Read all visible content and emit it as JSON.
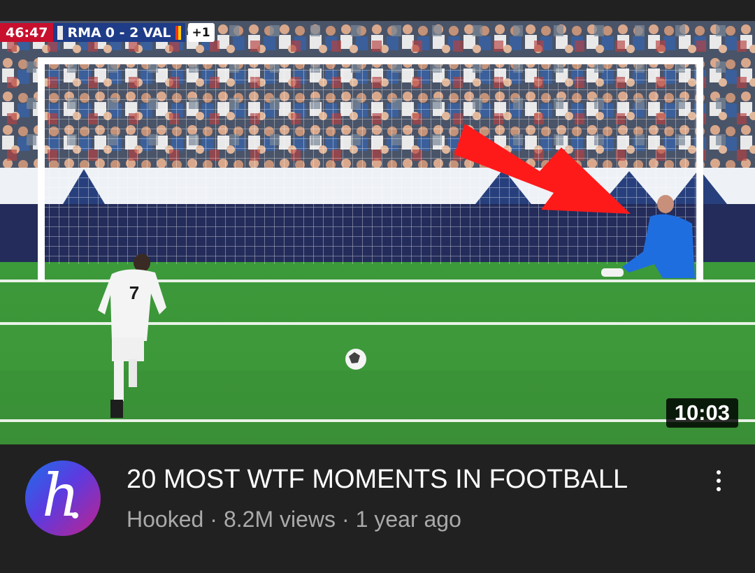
{
  "video": {
    "scoreboard": {
      "clock": "46:47",
      "home": "RMA",
      "score": "0 - 2",
      "away": "VAL",
      "extra_time": "+1"
    },
    "duration": "10:03",
    "title": "20 MOST WTF MOMENTS IN FOOTBALL",
    "channel": "Hooked",
    "views": "8.2M views",
    "age": "1 year ago",
    "separator": "·",
    "player_number": "7"
  },
  "channel_avatar": {
    "glyph": "h",
    "colors": [
      "#1e6fe8",
      "#5b3be0",
      "#c0228c"
    ]
  },
  "menu": {
    "icon": "more-vertical-icon"
  },
  "colors": {
    "background": "#212121",
    "pitch": "#3f9a3c",
    "arrow": "#ff1a1a",
    "meta_text": "#aaaaaa"
  }
}
